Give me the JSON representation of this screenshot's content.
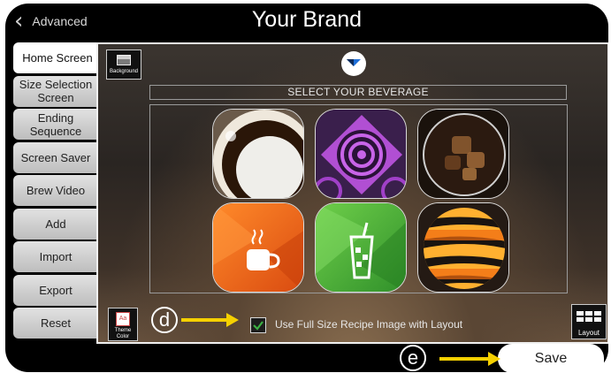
{
  "header": {
    "back_label": "Advanced",
    "title": "Your Brand"
  },
  "sidebar": {
    "items": [
      {
        "label": "Home Screen",
        "active": true
      },
      {
        "label": "Size Selection Screen"
      },
      {
        "label": "Ending Sequence"
      },
      {
        "label": "Screen Saver"
      },
      {
        "label": "Brew Video"
      },
      {
        "label": "Add"
      },
      {
        "label": "Import"
      },
      {
        "label": "Export"
      },
      {
        "label": "Reset"
      }
    ]
  },
  "main": {
    "background_button_label": "Background",
    "heading": "SELECT YOUR BEVERAGE",
    "tiles": [
      {
        "name": "hot-coffee-photo",
        "icon": "coffee-cup-photo"
      },
      {
        "name": "purple-spiral-pattern",
        "icon": "spiral-pattern"
      },
      {
        "name": "iced-coffee-photo",
        "icon": "iced-coffee-photo"
      },
      {
        "name": "hot-drink-icon-tile",
        "icon": "hot-cup-icon"
      },
      {
        "name": "iced-drink-icon-tile",
        "icon": "iced-cup-icon"
      },
      {
        "name": "orange-stripe-pattern",
        "icon": "stripe-pattern"
      }
    ],
    "full_size_checkbox_label": "Use Full Size Recipe Image with Layout",
    "full_size_checked": true,
    "theme_button_label": "Theme Color",
    "theme_button_icon_text": "Aa",
    "layout_button_label": "Layout"
  },
  "footer": {
    "save_label": "Save"
  },
  "annotations": {
    "callout_d": "d",
    "callout_e": "e"
  },
  "colors": {
    "accent_check": "#3cb043",
    "annotation_arrow": "#f5d000",
    "logo_blue": "#1e6fd9"
  }
}
